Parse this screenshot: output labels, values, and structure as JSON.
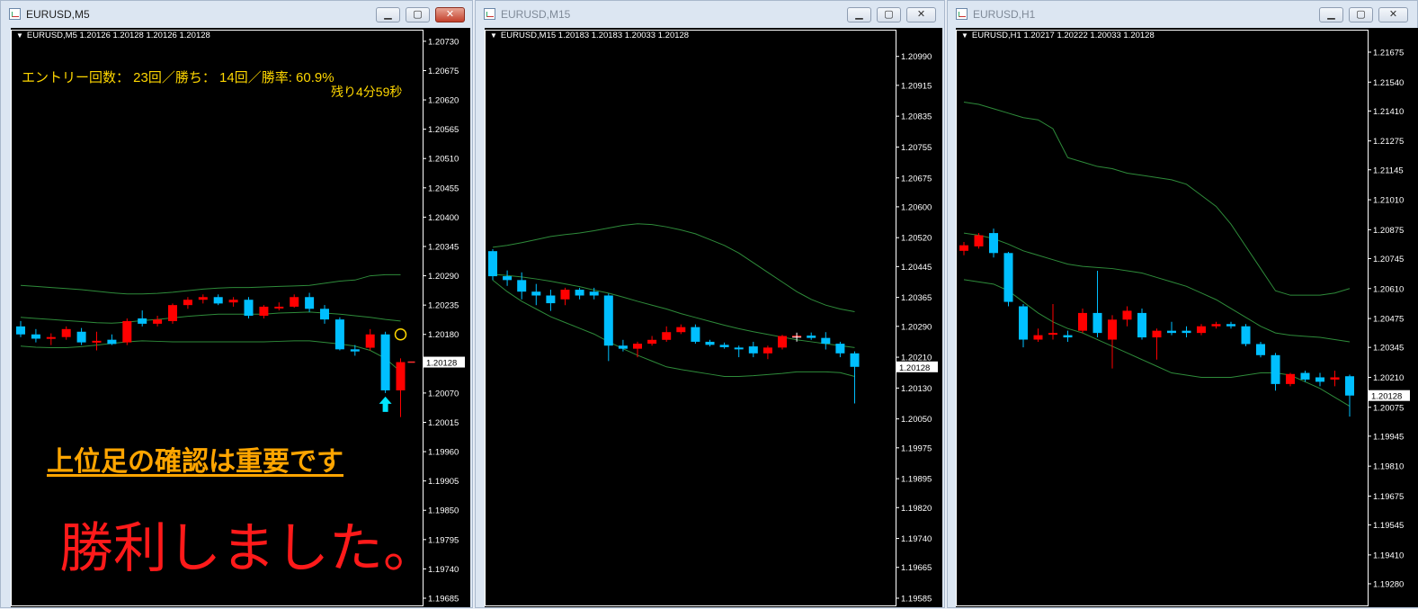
{
  "windows": [
    {
      "title": "EURUSD,M5",
      "active": true,
      "header": "EURUSD,M5  1.20126 1.20128 1.20126 1.20128",
      "price_label": "1.20128",
      "ticks": [
        "1.20730",
        "1.20675",
        "1.20620",
        "1.20565",
        "1.20510",
        "1.20455",
        "1.20400",
        "1.20345",
        "1.20290",
        "1.20235",
        "1.20180",
        "1.20125",
        "1.20070",
        "1.20015",
        "1.19960",
        "1.19905",
        "1.19850",
        "1.19795",
        "1.19740",
        "1.19685"
      ],
      "overlay": {
        "stats": "エントリー回数： 23回／勝ち： 14回／勝率: 60.9%",
        "timer": "残り4分59秒",
        "caption": "上位足の確認は重要です",
        "result": "勝利しました。"
      }
    },
    {
      "title": "EURUSD,M15",
      "active": false,
      "header": "EURUSD,M15  1.20183 1.20183 1.20033 1.20128",
      "price_label": "1.20128",
      "ticks": [
        "1.20990",
        "1.20915",
        "1.20835",
        "1.20755",
        "1.20675",
        "1.20600",
        "1.20520",
        "1.20445",
        "1.20365",
        "1.20290",
        "1.20210",
        "1.20130",
        "1.20050",
        "1.19975",
        "1.19895",
        "1.19820",
        "1.19740",
        "1.19665",
        "1.19585"
      ]
    },
    {
      "title": "EURUSD,H1",
      "active": false,
      "header": "EURUSD,H1  1.20217 1.20222 1.20033 1.20128",
      "price_label": "1.20128",
      "ticks": [
        "1.21675",
        "1.21540",
        "1.21410",
        "1.21275",
        "1.21145",
        "1.21010",
        "1.20875",
        "1.20745",
        "1.20610",
        "1.20475",
        "1.20345",
        "1.20210",
        "1.20075",
        "1.19945",
        "1.19810",
        "1.19675",
        "1.19545",
        "1.19410",
        "1.19280"
      ]
    }
  ],
  "chart_data": [
    {
      "type": "candlestick",
      "symbol": "EURUSD",
      "timeframe": "M5",
      "ylim": [
        1.19685,
        1.20745
      ],
      "colors": {
        "bull": "#ff0000",
        "bear": "#00bfff",
        "bands": "#2e8b3a"
      },
      "candles": [
        [
          1.20195,
          1.20205,
          1.20175,
          1.2018
        ],
        [
          1.2018,
          1.2019,
          1.20165,
          1.20172
        ],
        [
          1.20172,
          1.20182,
          1.2016,
          1.20175
        ],
        [
          1.20175,
          1.20195,
          1.2017,
          1.2019
        ],
        [
          1.20185,
          1.20192,
          1.2016,
          1.20165
        ],
        [
          1.20165,
          1.20185,
          1.2015,
          1.20168
        ],
        [
          1.2017,
          1.2018,
          1.2016,
          1.20162
        ],
        [
          1.20165,
          1.2021,
          1.2016,
          1.20205
        ],
        [
          1.2021,
          1.20225,
          1.20195,
          1.202
        ],
        [
          1.202,
          1.20215,
          1.20195,
          1.20208
        ],
        [
          1.20205,
          1.20238,
          1.202,
          1.20235
        ],
        [
          1.20235,
          1.2025,
          1.20228,
          1.20245
        ],
        [
          1.20245,
          1.20255,
          1.20238,
          1.2025
        ],
        [
          1.2025,
          1.20255,
          1.20235,
          1.20238
        ],
        [
          1.2024,
          1.2025,
          1.20232,
          1.20245
        ],
        [
          1.20245,
          1.2025,
          1.2021,
          1.20215
        ],
        [
          1.20215,
          1.20235,
          1.2021,
          1.20232
        ],
        [
          1.20232,
          1.2024,
          1.20225,
          1.20232
        ],
        [
          1.20232,
          1.20255,
          1.2023,
          1.2025
        ],
        [
          1.2025,
          1.20258,
          1.20222,
          1.20228
        ],
        [
          1.20228,
          1.20235,
          1.202,
          1.20208
        ],
        [
          1.20208,
          1.20212,
          1.2015,
          1.20152
        ],
        [
          1.20152,
          1.2016,
          1.2014,
          1.20148
        ],
        [
          1.20155,
          1.2019,
          1.2015,
          1.2018
        ],
        [
          1.2018,
          1.20185,
          1.2007,
          1.20075
        ],
        [
          1.20075,
          1.20135,
          1.20025,
          1.20128
        ]
      ],
      "bands": {
        "upper": [
          1.20272,
          1.2027,
          1.20268,
          1.20266,
          1.20264,
          1.20261,
          1.20258,
          1.20256,
          1.20256,
          1.20257,
          1.20259,
          1.20262,
          1.20265,
          1.20267,
          1.20268,
          1.20268,
          1.20269,
          1.2027,
          1.20271,
          1.20272,
          1.20276,
          1.2028,
          1.20282,
          1.2029,
          1.20292,
          1.20292
        ],
        "middle": [
          1.20212,
          1.2021,
          1.20208,
          1.20206,
          1.20204,
          1.20202,
          1.20201,
          1.20203,
          1.20206,
          1.20208,
          1.20211,
          1.20214,
          1.20216,
          1.20218,
          1.20218,
          1.20218,
          1.20218,
          1.2022,
          1.20221,
          1.20222,
          1.2022,
          1.20218,
          1.20215,
          1.20212,
          1.20208,
          1.20205
        ],
        "lower": [
          1.20158,
          1.20156,
          1.20155,
          1.20155,
          1.20157,
          1.2016,
          1.20163,
          1.20166,
          1.20168,
          1.20167,
          1.20166,
          1.20166,
          1.20166,
          1.20166,
          1.20166,
          1.20166,
          1.20166,
          1.20167,
          1.20168,
          1.20168,
          1.20165,
          1.20162,
          1.20158,
          1.2015,
          1.20135,
          1.2011
        ]
      },
      "entry_arrow": "up",
      "marker": "circle"
    },
    {
      "type": "candlestick",
      "symbol": "EURUSD",
      "timeframe": "M15",
      "ylim": [
        1.19585,
        1.2105
      ],
      "colors": {
        "bull": "#ff0000",
        "bear": "#00bfff",
        "bands": "#2e8b3a"
      },
      "candles": [
        [
          1.20485,
          1.2049,
          1.2041,
          1.2042
        ],
        [
          1.2042,
          1.20435,
          1.20395,
          1.2041
        ],
        [
          1.2041,
          1.2043,
          1.2036,
          1.2038
        ],
        [
          1.2038,
          1.204,
          1.20345,
          1.2037
        ],
        [
          1.2037,
          1.20385,
          1.2033,
          1.2035
        ],
        [
          1.2036,
          1.2039,
          1.20345,
          1.20385
        ],
        [
          1.20385,
          1.2039,
          1.2036,
          1.2037
        ],
        [
          1.2038,
          1.2039,
          1.2036,
          1.2037
        ],
        [
          1.2037,
          1.20375,
          1.202,
          1.2024
        ],
        [
          1.2024,
          1.20255,
          1.20225,
          1.20232
        ],
        [
          1.20232,
          1.2025,
          1.2021,
          1.20245
        ],
        [
          1.20245,
          1.20265,
          1.2024,
          1.20255
        ],
        [
          1.20255,
          1.2029,
          1.2025,
          1.20275
        ],
        [
          1.20275,
          1.20295,
          1.2027,
          1.20288
        ],
        [
          1.20288,
          1.20295,
          1.20245,
          1.2025
        ],
        [
          1.2025,
          1.20255,
          1.20238,
          1.20242
        ],
        [
          1.20242,
          1.20248,
          1.20232,
          1.20236
        ],
        [
          1.20235,
          1.2024,
          1.2021,
          1.20234
        ],
        [
          1.20238,
          1.2025,
          1.2021,
          1.2022
        ],
        [
          1.2022,
          1.2024,
          1.20205,
          1.20235
        ],
        [
          1.20235,
          1.20268,
          1.2023,
          1.20265
        ],
        [
          1.20265,
          1.20272,
          1.20258,
          1.20266
        ],
        [
          1.20266,
          1.20274,
          1.20255,
          1.2026
        ],
        [
          1.2026,
          1.20275,
          1.2023,
          1.20245
        ],
        [
          1.20245,
          1.2025,
          1.2021,
          1.2022
        ],
        [
          1.2022,
          1.20225,
          1.2009,
          1.20185
        ]
      ],
      "bands": {
        "upper": [
          1.20495,
          1.205,
          1.20507,
          1.20515,
          1.20523,
          1.20528,
          1.20532,
          1.20538,
          1.20545,
          1.20552,
          1.20556,
          1.20554,
          1.20548,
          1.2054,
          1.2053,
          1.20515,
          1.205,
          1.2048,
          1.20455,
          1.2043,
          1.20405,
          1.2038,
          1.2036,
          1.20345,
          1.20335,
          1.20328
        ],
        "middle": [
          1.20425,
          1.20422,
          1.20418,
          1.20413,
          1.20407,
          1.204,
          1.20393,
          1.20384,
          1.20376,
          1.20366,
          1.20355,
          1.20345,
          1.20335,
          1.20323,
          1.20313,
          1.20303,
          1.20293,
          1.20284,
          1.20276,
          1.20269,
          1.20262,
          1.20255,
          1.2025,
          1.20245,
          1.2024,
          1.20235
        ],
        "lower": [
          1.2041,
          1.2038,
          1.20355,
          1.20335,
          1.20315,
          1.203,
          1.20285,
          1.2027,
          1.2025,
          1.20232,
          1.20215,
          1.202,
          1.20185,
          1.20178,
          1.20172,
          1.20166,
          1.2016,
          1.2016,
          1.20162,
          1.20165,
          1.20168,
          1.20172,
          1.20172,
          1.20172,
          1.2017,
          1.2016
        ]
      }
    },
    {
      "type": "candlestick",
      "symbol": "EURUSD",
      "timeframe": "H1",
      "ylim": [
        1.19215,
        1.2176
      ],
      "colors": {
        "bull": "#ff0000",
        "bear": "#00bfff",
        "bands": "#2e8b3a"
      },
      "candles": [
        [
          1.2078,
          1.2082,
          1.2076,
          1.20805
        ],
        [
          1.208,
          1.2086,
          1.2079,
          1.2085
        ],
        [
          1.2086,
          1.2088,
          1.2075,
          1.2077
        ],
        [
          1.2077,
          1.20775,
          1.2053,
          1.2055
        ],
        [
          1.2053,
          1.2054,
          1.20345,
          1.2038
        ],
        [
          1.2038,
          1.2043,
          1.2037,
          1.204
        ],
        [
          1.2041,
          1.2054,
          1.2038,
          1.2041
        ],
        [
          1.204,
          1.2042,
          1.2037,
          1.2039
        ],
        [
          1.2042,
          1.2052,
          1.2041,
          1.205
        ],
        [
          1.205,
          1.2069,
          1.2039,
          1.2041
        ],
        [
          1.2038,
          1.2049,
          1.2025,
          1.2047
        ],
        [
          1.2047,
          1.2053,
          1.2044,
          1.2051
        ],
        [
          1.205,
          1.2052,
          1.2038,
          1.2039
        ],
        [
          1.2039,
          1.2043,
          1.2029,
          1.2042
        ],
        [
          1.2042,
          1.2046,
          1.204,
          1.2041
        ],
        [
          1.2042,
          1.2044,
          1.2039,
          1.2041
        ],
        [
          1.2041,
          1.2045,
          1.204,
          1.2044
        ],
        [
          1.2044,
          1.2046,
          1.2043,
          1.2045
        ],
        [
          1.2045,
          1.2046,
          1.2043,
          1.2044
        ],
        [
          1.2044,
          1.2045,
          1.2035,
          1.2036
        ],
        [
          1.2036,
          1.2037,
          1.203,
          1.2031
        ],
        [
          1.2031,
          1.2032,
          1.2015,
          1.2018
        ],
        [
          1.2018,
          1.2023,
          1.2017,
          1.20225
        ],
        [
          1.2023,
          1.2024,
          1.2019,
          1.202
        ],
        [
          1.2021,
          1.2023,
          1.2017,
          1.2019
        ],
        [
          1.202,
          1.2024,
          1.2017,
          1.2021
        ],
        [
          1.20215,
          1.20222,
          1.20033,
          1.20128
        ]
      ],
      "bands": {
        "upper": [
          1.2145,
          1.2144,
          1.2142,
          1.214,
          1.2138,
          1.2137,
          1.2133,
          1.212,
          1.2118,
          1.2116,
          1.2115,
          1.2113,
          1.2112,
          1.2111,
          1.211,
          1.2108,
          1.2103,
          1.2098,
          1.209,
          1.208,
          1.207,
          1.206,
          1.2058,
          1.2058,
          1.2058,
          1.2059,
          1.2061
        ],
        "middle": [
          1.2086,
          1.2085,
          1.20835,
          1.2081,
          1.2078,
          1.2076,
          1.2074,
          1.2072,
          1.2071,
          1.20705,
          1.207,
          1.2069,
          1.2068,
          1.2066,
          1.2064,
          1.2062,
          1.2059,
          1.2056,
          1.2052,
          1.2048,
          1.2044,
          1.2041,
          1.204,
          1.20395,
          1.2039,
          1.2038,
          1.2037
        ],
        "lower": [
          1.2065,
          1.2064,
          1.2063,
          1.206,
          1.2055,
          1.205,
          1.2046,
          1.2043,
          1.2041,
          1.2038,
          1.2035,
          1.2032,
          1.2029,
          1.2026,
          1.2023,
          1.2022,
          1.2021,
          1.2021,
          1.2021,
          1.2022,
          1.2023,
          1.2023,
          1.2022,
          1.2019,
          1.2016,
          1.2012,
          1.2008
        ]
      }
    }
  ]
}
